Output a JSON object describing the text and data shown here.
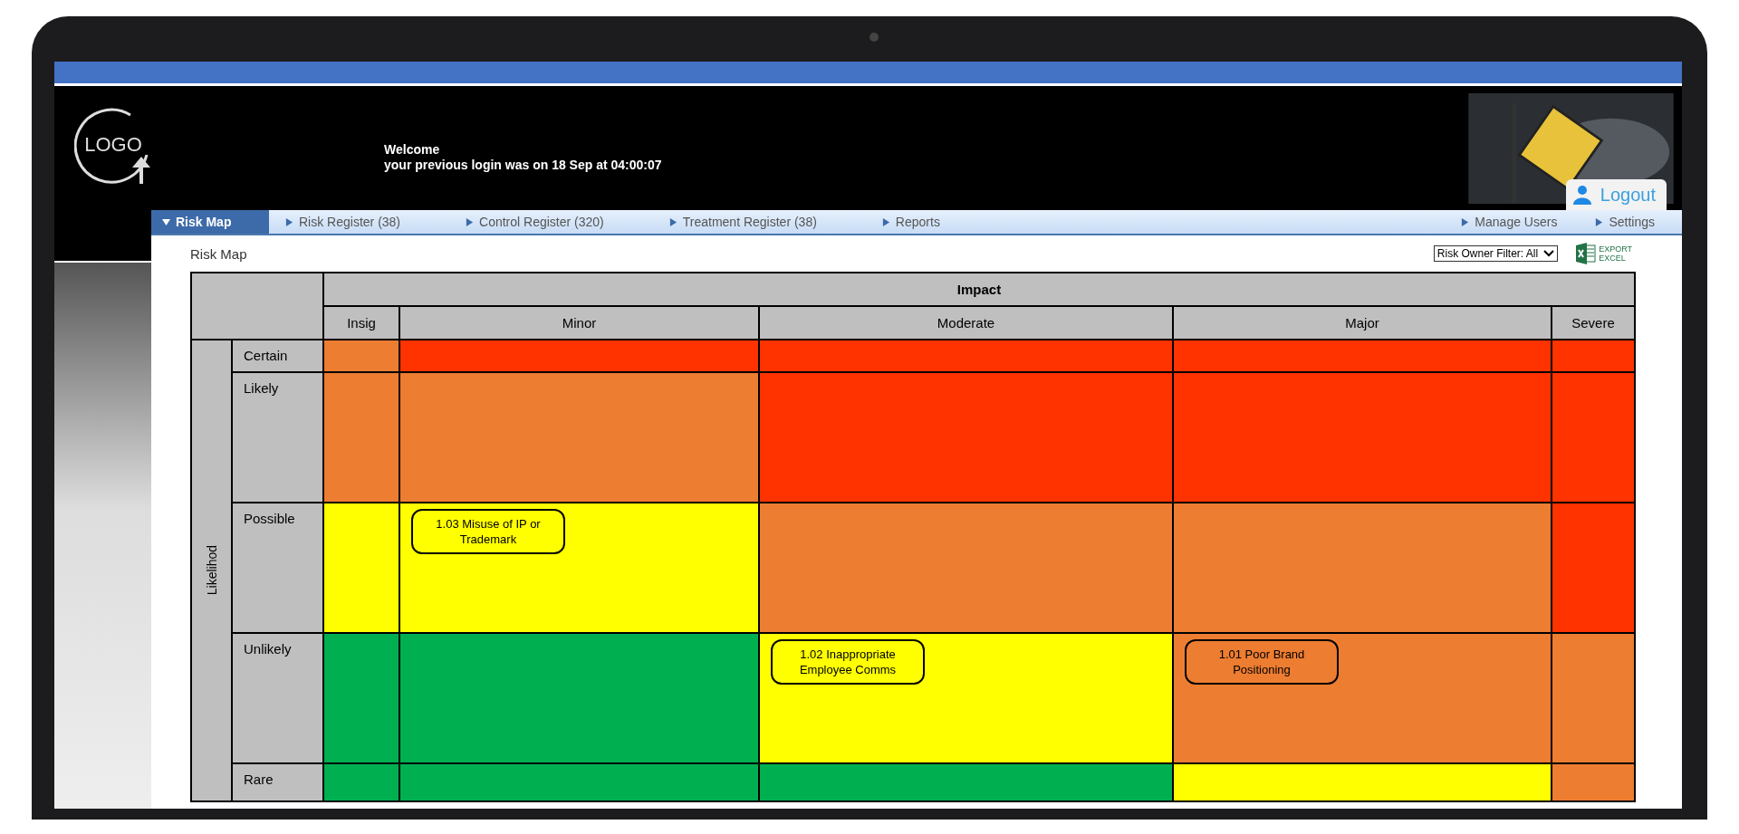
{
  "header": {
    "welcome": "Welcome",
    "last_login": "your previous login was on 18 Sep at 04:00:07",
    "logo": "LOGO",
    "logout": "Logout"
  },
  "nav": {
    "left": [
      {
        "label": "Risk Map",
        "selected": true
      },
      {
        "label": "Risk Register (38)",
        "selected": false
      },
      {
        "label": "Control Register (320)",
        "selected": false
      },
      {
        "label": "Treatment Register (38)",
        "selected": false
      },
      {
        "label": "Reports",
        "selected": false
      }
    ],
    "right": [
      {
        "label": "Manage Users",
        "selected": false
      },
      {
        "label": "Settings",
        "selected": false
      }
    ]
  },
  "page_title": "Risk Map",
  "filter": {
    "value": "Risk Owner Filter: All"
  },
  "export": {
    "line_1": "EXPORT",
    "line_2": "EXCEL"
  },
  "risk_map": {
    "impact_title": "Impact",
    "likelihood_title": "Likelihod",
    "impact_levels": [
      "Insig",
      "Minor",
      "Moderate",
      "Major",
      "Severe"
    ],
    "rows": [
      {
        "label": "Certain",
        "cells": [
          {
            "color": "#ed7d31"
          },
          {
            "color": "#ff3300"
          },
          {
            "color": "#ff3300"
          },
          {
            "color": "#ff3300"
          },
          {
            "color": "#ff3300"
          }
        ]
      },
      {
        "label": "Likely",
        "cells": [
          {
            "color": "#ed7d31"
          },
          {
            "color": "#ed7d31"
          },
          {
            "color": "#ff3300"
          },
          {
            "color": "#ff3300"
          },
          {
            "color": "#ff3300"
          }
        ]
      },
      {
        "label": "Possible",
        "cells": [
          {
            "color": "#ffff00"
          },
          {
            "color": "#ffff00",
            "risks": [
              "1.03 Misuse of IP or Trademark"
            ]
          },
          {
            "color": "#ed7d31"
          },
          {
            "color": "#ed7d31"
          },
          {
            "color": "#ff3300"
          }
        ]
      },
      {
        "label": "Unlikely",
        "cells": [
          {
            "color": "#00b050"
          },
          {
            "color": "#00b050"
          },
          {
            "color": "#ffff00",
            "risks": [
              "1.02 Inappropriate Employee Comms"
            ]
          },
          {
            "color": "#ed7d31",
            "risks": [
              "1.01 Poor Brand Positioning"
            ]
          },
          {
            "color": "#ed7d31"
          }
        ]
      },
      {
        "label": "Rare",
        "cells": [
          {
            "color": "#00b050"
          },
          {
            "color": "#00b050"
          },
          {
            "color": "#00b050"
          },
          {
            "color": "#ffff00"
          },
          {
            "color": "#ed7d31"
          }
        ]
      }
    ]
  }
}
